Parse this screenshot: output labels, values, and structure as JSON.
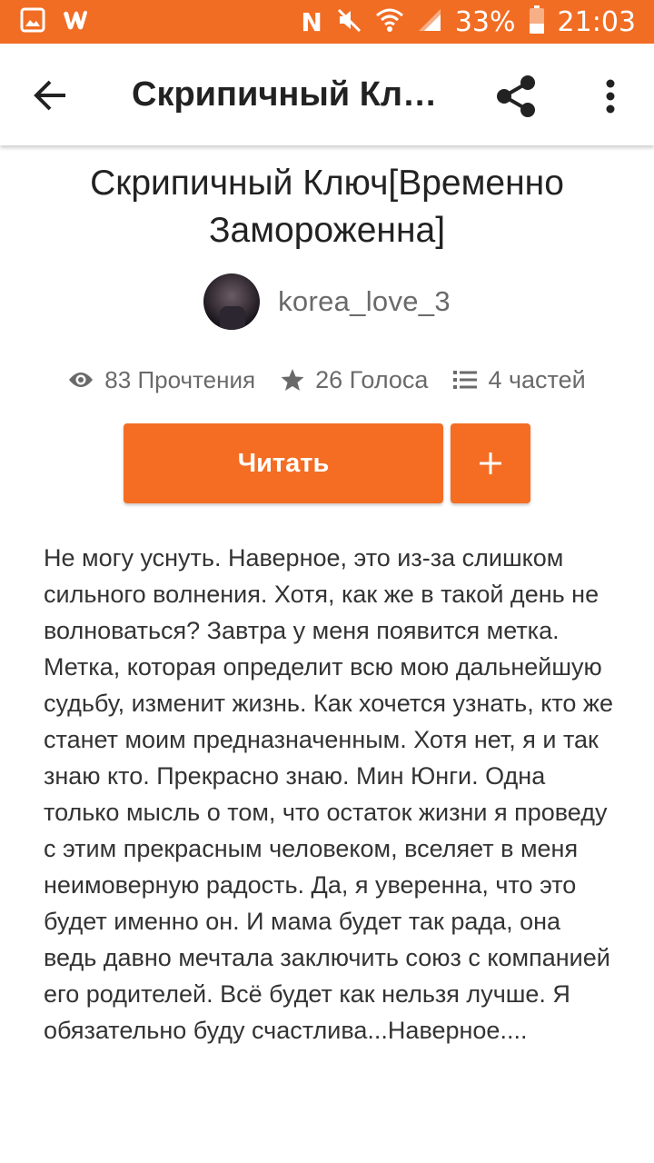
{
  "status_bar": {
    "battery": "33%",
    "time": "21:03",
    "icons": [
      "image-icon",
      "wattpad-icon",
      "nfc-icon",
      "mute-icon",
      "wifi-icon",
      "signal-icon",
      "battery-icon"
    ]
  },
  "toolbar": {
    "title": "Скрипичный Ключ[Временно Замороженна]",
    "icons": [
      "back-arrow-icon",
      "share-icon",
      "more-vert-icon"
    ]
  },
  "story": {
    "title": "Скрипичный Ключ[Временно Замороженна]",
    "author": "korea_love_3",
    "reads": "83 Прочтения",
    "votes": "26 Голоса",
    "parts": "4 частей",
    "read_button": "Читать",
    "description": "Не могу уснуть. Наверное, это из-за слишком сильного волнения. Хотя, как же в такой день не волноваться? Завтра у меня появится метка. Метка, которая определит всю мою дальнейшую судьбу, изменит жизнь. Как хочется узнать, кто же станет моим предназначенным. Хотя нет, я и так знаю кто. Прекрасно знаю. Мин Юнги. Одна только мысль о том, что остаток жизни я проведу с этим прекрасным человеком, вселяет в меня неимоверную радость. Да, я уверенна, что это будет именно он. И мама будет так рада, она ведь давно мечтала заключить союз с компанией его родителей. Всё будет как нельзя лучше. Я обязательно буду счастлива...Наверное...."
  },
  "colors": {
    "accent": "#f46d23",
    "status_bar": "#f16d24"
  }
}
